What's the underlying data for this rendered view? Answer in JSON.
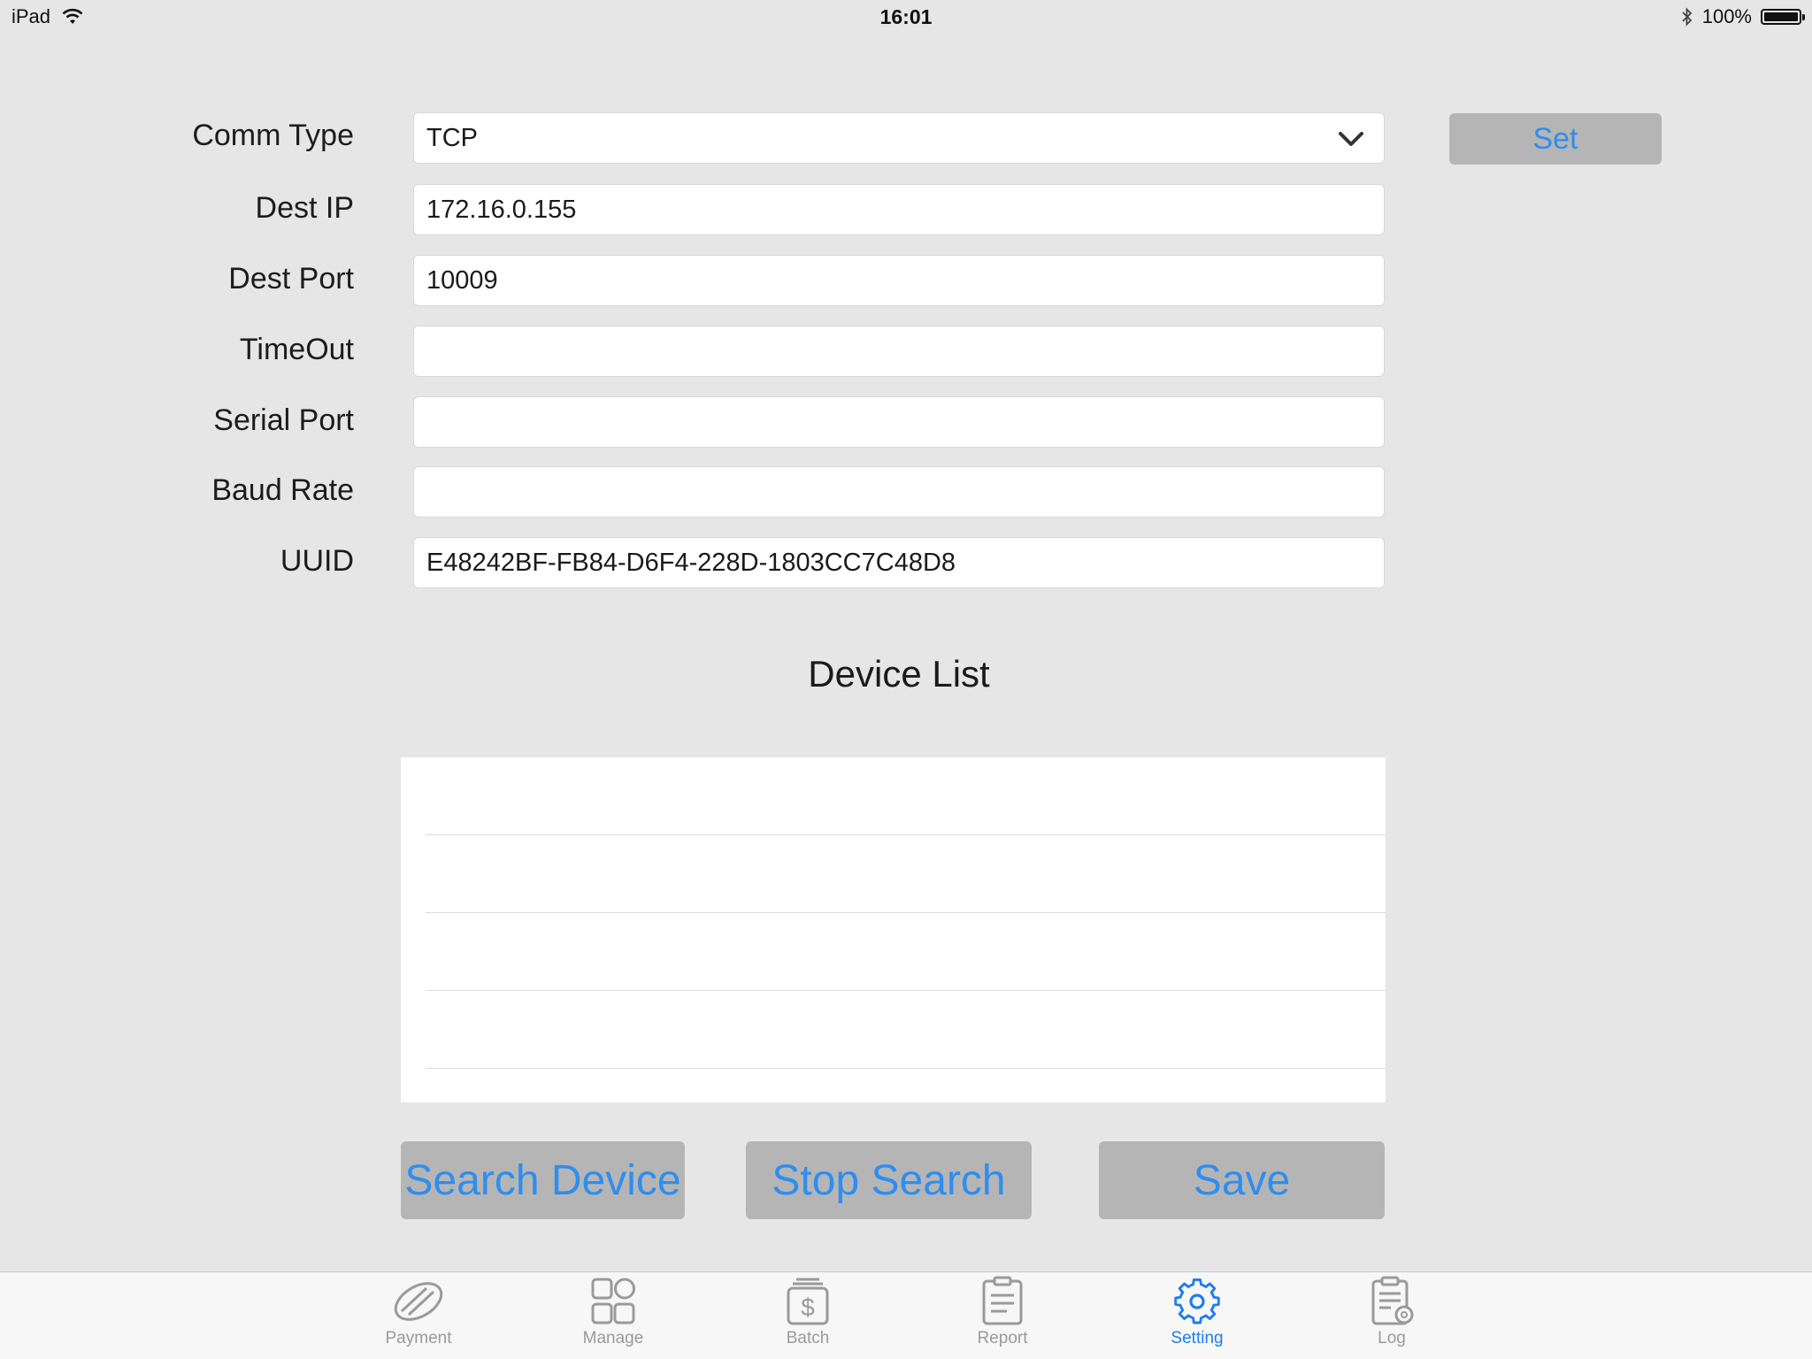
{
  "status_bar": {
    "device": "iPad",
    "time": "16:01",
    "battery": "100%"
  },
  "form": {
    "comm_type": {
      "label": "Comm Type",
      "value": "TCP"
    },
    "dest_ip": {
      "label": "Dest IP",
      "value": "172.16.0.155"
    },
    "dest_port": {
      "label": "Dest Port",
      "value": "10009"
    },
    "timeout": {
      "label": "TimeOut",
      "value": ""
    },
    "serial_port": {
      "label": "Serial Port",
      "value": ""
    },
    "baud_rate": {
      "label": "Baud Rate",
      "value": ""
    },
    "uuid": {
      "label": "UUID",
      "value": "E48242BF-FB84-D6F4-228D-1803CC7C48D8"
    }
  },
  "set_button": "Set",
  "device_list": {
    "title": "Device List",
    "rows": [
      "",
      "",
      "",
      ""
    ]
  },
  "actions": {
    "search": "Search Device",
    "stop": "Stop Search",
    "save": "Save"
  },
  "tabs": [
    {
      "label": "Payment",
      "icon": "payment-icon",
      "active": false
    },
    {
      "label": "Manage",
      "icon": "manage-icon",
      "active": false
    },
    {
      "label": "Batch",
      "icon": "batch-icon",
      "active": false
    },
    {
      "label": "Report",
      "icon": "report-icon",
      "active": false
    },
    {
      "label": "Setting",
      "icon": "gear-icon",
      "active": true
    },
    {
      "label": "Log",
      "icon": "log-icon",
      "active": false
    }
  ],
  "colors": {
    "accent": "#2e8ef0",
    "button_bg": "#b5b5b5",
    "background": "#e6e6e6"
  }
}
